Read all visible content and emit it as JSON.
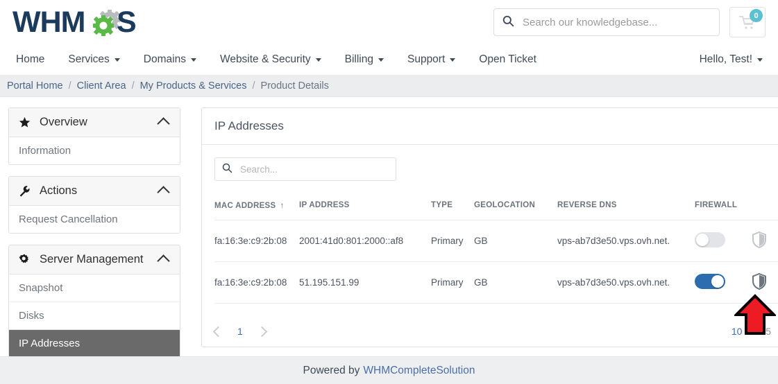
{
  "header": {
    "logo_text": "WHMCS",
    "search": {
      "placeholder": "Search our knowledgebase...",
      "value": "",
      "icon": "search-icon"
    },
    "cart": {
      "icon": "shopping-cart-icon",
      "badge": "0"
    }
  },
  "navbar": {
    "items": [
      {
        "label": "Home",
        "has_caret": false
      },
      {
        "label": "Services",
        "has_caret": true
      },
      {
        "label": "Domains",
        "has_caret": true
      },
      {
        "label": "Website & Security",
        "has_caret": true
      },
      {
        "label": "Billing",
        "has_caret": true
      },
      {
        "label": "Support",
        "has_caret": true
      },
      {
        "label": "Open Ticket",
        "has_caret": false
      }
    ],
    "account": {
      "label": "Hello, Test!",
      "has_caret": true
    }
  },
  "breadcrumb": {
    "items": [
      "Portal Home",
      "Client Area",
      "My Products & Services",
      "Product Details"
    ],
    "separator": "/"
  },
  "sidebar": {
    "panels": [
      {
        "title": "Overview",
        "icon": "star-icon",
        "collapse_icon": "chevron-up-icon",
        "links": [
          {
            "label": "Information",
            "active": false
          }
        ]
      },
      {
        "title": "Actions",
        "icon": "wrench-icon",
        "collapse_icon": "chevron-up-icon",
        "links": [
          {
            "label": "Request Cancellation",
            "active": false
          }
        ]
      },
      {
        "title": "Server Management",
        "icon": "gear-icon",
        "collapse_icon": "chevron-up-icon",
        "links": [
          {
            "label": "Snapshot",
            "active": false
          },
          {
            "label": "Disks",
            "active": false
          },
          {
            "label": "IP Addresses",
            "active": true
          }
        ]
      }
    ]
  },
  "main": {
    "card_title": "IP Addresses",
    "table_search": {
      "placeholder": "Search...",
      "value": "",
      "icon": "search-icon"
    },
    "table": {
      "columns": [
        {
          "label": "MAC ADDRESS",
          "sorted": true,
          "sort_icon": "↑"
        },
        {
          "label": "IP ADDRESS",
          "sorted": false
        },
        {
          "label": "TYPE",
          "sorted": false
        },
        {
          "label": "GEOLOCATION",
          "sorted": false
        },
        {
          "label": "REVERSE DNS",
          "sorted": false
        },
        {
          "label": "FIREWALL",
          "sorted": false
        }
      ],
      "rows": [
        {
          "mac": "fa:16:3e:c9:2b:08",
          "ip": "2001:41d0:801:2000::af8",
          "type": "Primary",
          "geolocation": "GB",
          "reverse_dns": "vps-ab7d3e50.vps.ovh.net.",
          "firewall_enabled": false,
          "shield_icon": "shield-half-icon",
          "exchange_icon": "exchange-arrows-icon"
        },
        {
          "mac": "fa:16:3e:c9:2b:08",
          "ip": "51.195.151.99",
          "type": "Primary",
          "geolocation": "GB",
          "reverse_dns": "vps-ab7d3e50.vps.ovh.net.",
          "firewall_enabled": true,
          "shield_icon": "shield-half-icon",
          "exchange_icon": "exchange-arrows-icon"
        }
      ]
    },
    "pagination": {
      "prev_icon": "chevron-left-icon",
      "next_icon": "chevron-right-icon",
      "pages": [
        "1"
      ],
      "current_page": "1",
      "per_page_options": [
        "10",
        "25"
      ],
      "per_page_selected": "10"
    }
  },
  "footer": {
    "powered_text": "Powered by",
    "brand": "WHMCompleteSolution"
  },
  "annotation": {
    "arrow": {
      "color": "#ed1c24",
      "outline": "#000000",
      "direction": "up"
    }
  },
  "colors": {
    "toggle_on": "#2d6cae",
    "toggle_off": "#e2e4e8",
    "sidebar_active_bg": "#6a6a6a",
    "link": "#3a6fb5",
    "badge": "#5bc0cf",
    "logo_dark": "#1b3a5c",
    "logo_green": "#5bba47"
  }
}
